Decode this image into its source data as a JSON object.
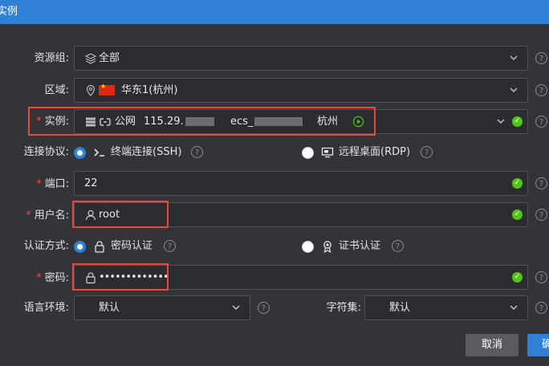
{
  "dialog": {
    "title": "实例"
  },
  "resource_group": {
    "label": "资源组:",
    "value": "全部",
    "icon": "layers-icon"
  },
  "region": {
    "label": "区域:",
    "value": "华东1(杭州)",
    "icon": "location-pin-icon"
  },
  "instance": {
    "label": "实例:",
    "network": "公网",
    "ip_prefix": "115.29.",
    "id_prefix": "ecs_",
    "city": "杭州",
    "status_color": "#52c41a"
  },
  "protocol": {
    "label": "连接协议:",
    "ssh_label": "终端连接(SSH)",
    "rdp_label": "远程桌面(RDP)",
    "selected": "ssh"
  },
  "port": {
    "label": "端口:",
    "value": "22"
  },
  "username": {
    "label": "用户名:",
    "value": "root"
  },
  "auth": {
    "label": "认证方式:",
    "password_label": "密码认证",
    "cert_label": "证书认证",
    "selected": "password"
  },
  "password": {
    "label": "密码:",
    "value": "•••••••••••••"
  },
  "locale": {
    "label": "语言环境:",
    "value": "默认"
  },
  "charset": {
    "label": "字符集:",
    "value": "默认"
  },
  "footer": {
    "cancel_label": "取消",
    "confirm_label": "确"
  },
  "colors": {
    "accent": "#2f80d6",
    "highlight": "#e24b3b",
    "success": "#52c41a",
    "required": "#e5484d"
  }
}
